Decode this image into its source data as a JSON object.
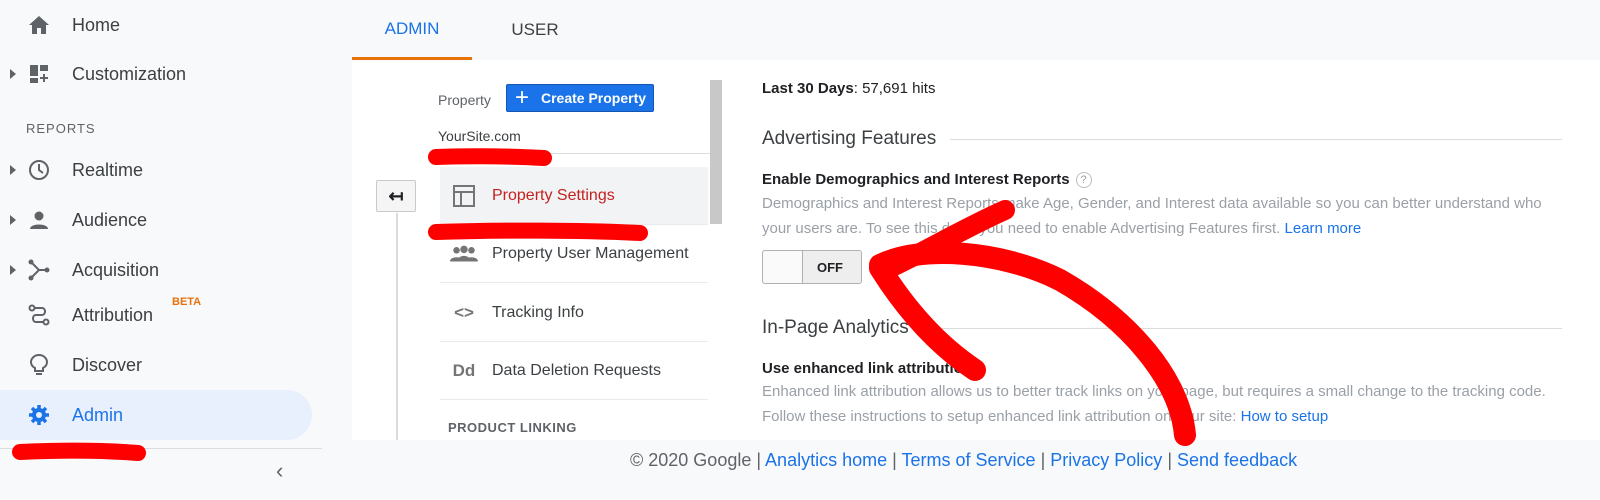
{
  "sidebar": {
    "items": [
      {
        "label": "Home",
        "icon": "home-icon"
      },
      {
        "label": "Customization",
        "icon": "dashboard-icon"
      },
      {
        "label": "Realtime",
        "icon": "clock-icon"
      },
      {
        "label": "Audience",
        "icon": "person-icon"
      },
      {
        "label": "Acquisition",
        "icon": "acquisition-icon"
      },
      {
        "label": "Attribution",
        "icon": "attribution-icon",
        "badge": "BETA"
      },
      {
        "label": "Discover",
        "icon": "lightbulb-icon"
      },
      {
        "label": "Admin",
        "icon": "gear-icon"
      }
    ],
    "section_label": "REPORTS",
    "collapse_glyph": "‹"
  },
  "tabs": {
    "admin": "ADMIN",
    "user": "USER"
  },
  "property": {
    "label": "Property",
    "create_button": "Create Property",
    "site_name": "YourSite.com",
    "back_glyph": "↤",
    "menu": [
      {
        "label": "Property Settings",
        "icon": "layout-icon"
      },
      {
        "label": "Property User Management",
        "icon": "people-icon"
      },
      {
        "label": "Tracking Info",
        "icon": "code-icon",
        "glyph": "<>"
      },
      {
        "label": "Data Deletion Requests",
        "icon": "dd-icon",
        "glyph": "Dd"
      }
    ],
    "product_linking": "PRODUCT LINKING"
  },
  "content": {
    "hits_label": "Last 30 Days",
    "hits_value": ": 57,691 hits",
    "advertising_heading": "Advertising Features",
    "demographics_title": "Enable Demographics and Interest Reports",
    "help_glyph": "?",
    "demographics_desc": "Demographics and Interest Reports make Age, Gender, and Interest data available so you can better understand who your users are. To see this data, you need to enable Advertising Features first.",
    "learn_more": "Learn more",
    "toggle_state": "OFF",
    "inpage_heading": "In-Page Analytics",
    "link_attr_title": "Use enhanced link attribution",
    "link_attr_desc": "Enhanced link attribution allows us to better track links on your page, but requires a small change to the tracking code. Follow these instructions to setup enhanced link attribution on your site:",
    "how_to_setup": "How to setup"
  },
  "footer": {
    "copyright": "© 2020 Google |",
    "analytics_home": "Analytics home",
    "sep": "|",
    "terms": "Terms of Service",
    "privacy": "Privacy Policy",
    "feedback": "Send feedback"
  },
  "colors": {
    "accent": "#1a73e8",
    "annotation": "#ff0000",
    "active_red": "#c5221f",
    "beta_orange": "#e8710a"
  }
}
